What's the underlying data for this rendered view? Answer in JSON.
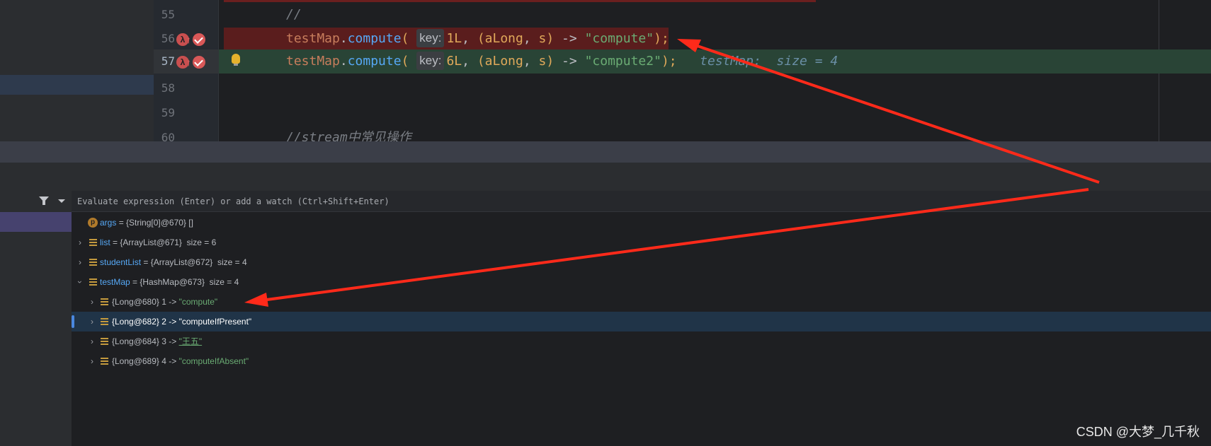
{
  "editor": {
    "lines": [
      {
        "num": "55"
      },
      {
        "num": "56",
        "hint": "key:"
      },
      {
        "num": "57",
        "hint": "key:",
        "inline": "testMap:  size = 4"
      },
      {
        "num": "58"
      },
      {
        "num": "59"
      },
      {
        "num": "60",
        "comment": "//stream中常见操作"
      }
    ],
    "line55_comment": "//",
    "tokens": {
      "var": "testMap",
      "dot": ".",
      "fn": "compute",
      "open": "(",
      "num1": "1L",
      "num2": "6L",
      "comma": ", ",
      "lp": "(",
      "p1": "aLong",
      "p2": "s",
      "rp": ")",
      "arrow": " -> ",
      "str1": "\"compute\"",
      "str2": "\"compute2\"",
      "end": ");"
    },
    "gutter_icons": [
      "lambda-icon",
      "arrow-up-icon",
      "breakpoint-icon",
      "lightbulb-icon"
    ]
  },
  "debugger": {
    "eval_placeholder": "Evaluate expression (Enter) or add a watch (Ctrl+Shift+Enter)",
    "variables": [
      {
        "name": "args",
        "value": "= {String[0]@670} []",
        "icon": "p"
      },
      {
        "name": "list",
        "value": "= {ArrayList@671}  size = 6",
        "icon": "f"
      },
      {
        "name": "studentList",
        "value": "= {ArrayList@672}  size = 4",
        "icon": "f"
      },
      {
        "name": "testMap",
        "value": "= {HashMap@673}  size = 4",
        "icon": "f"
      }
    ],
    "entries": [
      {
        "key": "{Long@680} 1 -> ",
        "val": "\"compute\""
      },
      {
        "key": "{Long@682} 2 -> ",
        "val": "\"computeIfPresent\""
      },
      {
        "key": "{Long@684} 3 -> ",
        "val": "\"王五\""
      },
      {
        "key": "{Long@689} 4 -> ",
        "val": "\"computeIfAbsent\""
      }
    ]
  },
  "colors": {
    "arrow": "#ff2a1a",
    "breakpoint_line": "#5a1d1d",
    "execution_line": "#294436"
  },
  "watermark": "CSDN @大梦_几千秋"
}
